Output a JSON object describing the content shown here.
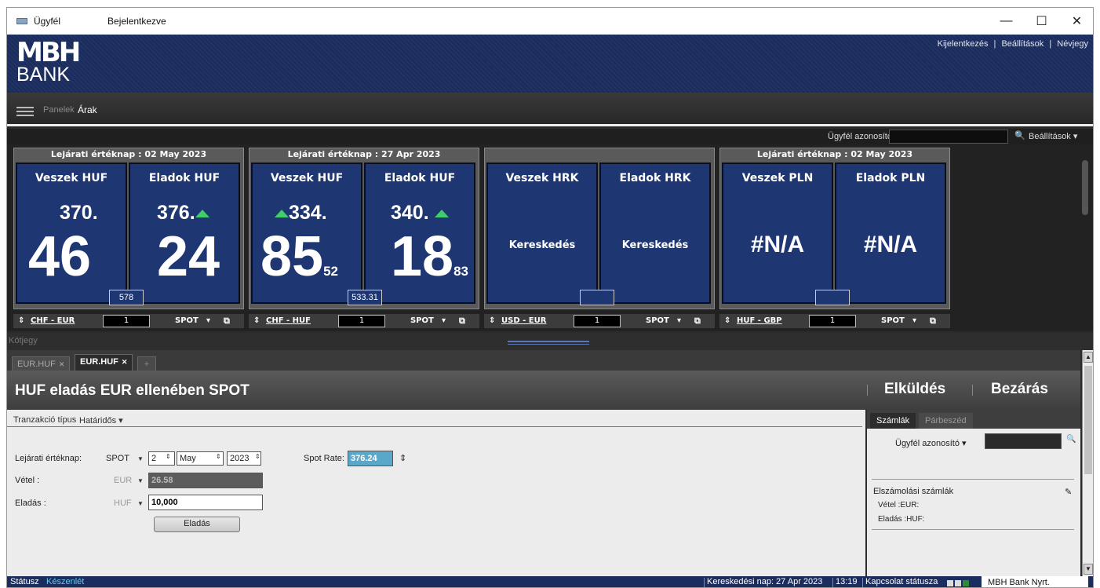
{
  "window": {
    "title": "Ügyfél",
    "status": "Bejelentkezve",
    "controls": {
      "minimize": "—",
      "maximize": "☐",
      "close": "✕"
    }
  },
  "banner": {
    "logo_line1": "MBH",
    "logo_line2": "BANK",
    "links": [
      "Kijelentkezés",
      "|",
      "Beállítások",
      "|",
      "Névjegy"
    ]
  },
  "nav": {
    "panelek": "Panelek",
    "arak": "Árak"
  },
  "toolbar": {
    "client_id_label": "Ügyfél azonosító ▾",
    "search_icon": "🔍",
    "sep": "|",
    "settings_label": "Beállítások ▾"
  },
  "tiles": [
    {
      "expiry": "Lejárati értéknap : 02 May 2023",
      "buy_label": "Veszek HUF",
      "sell_label": "Eladok HUF",
      "buy_small": "370.",
      "buy_big": "46",
      "buy_pip": "",
      "sell_small": "376.",
      "sell_big": "24",
      "sell_pip": "",
      "spread": "578",
      "pair_base": "CHF",
      "pair_dot": " - ",
      "pair_quote": "EUR",
      "amount": "1",
      "tenor": "SPOT"
    },
    {
      "expiry": "Lejárati értéknap : 27 Apr 2023",
      "buy_label": "Veszek HUF",
      "sell_label": "Eladok HUF",
      "buy_small": "334.",
      "buy_big": "85",
      "buy_pip": "52",
      "sell_small": "340.",
      "sell_big": "18",
      "sell_pip": "83",
      "spread": "533.31",
      "pair_base": "CHF",
      "pair_dot": " - ",
      "pair_quote": "HUF",
      "amount": "1",
      "tenor": "SPOT"
    },
    {
      "expiry": "",
      "buy_label": "Veszek HRK",
      "sell_label": "Eladok HRK",
      "buy_mid": "Kereskedés",
      "sell_mid": "Kereskedés",
      "spread": "",
      "pair_base": "USD",
      "pair_dot": " - ",
      "pair_quote": "EUR",
      "amount": "1",
      "tenor": "SPOT"
    },
    {
      "expiry": "Lejárati értéknap : 02 May 2023",
      "buy_label": "Veszek PLN",
      "sell_label": "Eladok PLN",
      "buy_na": "#N/A",
      "sell_na": "#N/A",
      "spread": "",
      "pair_base": "HUF",
      "pair_dot": " - ",
      "pair_quote": "GBP",
      "amount": "1",
      "tenor": "SPOT"
    }
  ],
  "kotjegy": "Kötjegy",
  "tabs": [
    {
      "label": "EUR.HUF"
    },
    {
      "label": "EUR.HUF"
    },
    {
      "label": "+"
    }
  ],
  "form": {
    "title": "HUF eladás EUR ellenében SPOT",
    "send": "Elküldés",
    "close": "Bezárás",
    "tran_type_label": "Tranzakció típus",
    "tran_type_value": "Határidős ▾",
    "expiry_label": "Lejárati értéknap:",
    "expiry_tenor": "SPOT",
    "day": "2",
    "month": "May",
    "year": "2023",
    "spot_rate_label": "Spot Rate:",
    "spot_rate_value": "376.24",
    "buy_label": "Vétel :",
    "buy_ccy": "EUR",
    "buy_amount": "26.58",
    "sell_label": "Eladás :",
    "sell_ccy": "HUF",
    "sell_amount": "10,000",
    "action_button": "Eladás"
  },
  "right": {
    "tab_accounts": "Számlák",
    "tab_dialog": "Párbeszéd",
    "client_id_label": "Ügyfél azonosító",
    "settlement_label": "Elszámolási számlák",
    "buy_line": "Vétel :EUR:",
    "sell_line": "Eladás :HUF:"
  },
  "statusbar": {
    "status_label": "Státusz",
    "status_value": "Készenlét",
    "trading_day": "Kereskedési nap: 27 Apr 2023",
    "time": "13:19",
    "conn": "Kapcsolat státusza",
    "bank": "MBH Bank Nyrt."
  },
  "colors": {
    "banner": "#1b2d5e",
    "tile": "#1e3772",
    "up_arrow": "#3fcf6a",
    "spot_rate_bg": "#5aa8c9"
  }
}
